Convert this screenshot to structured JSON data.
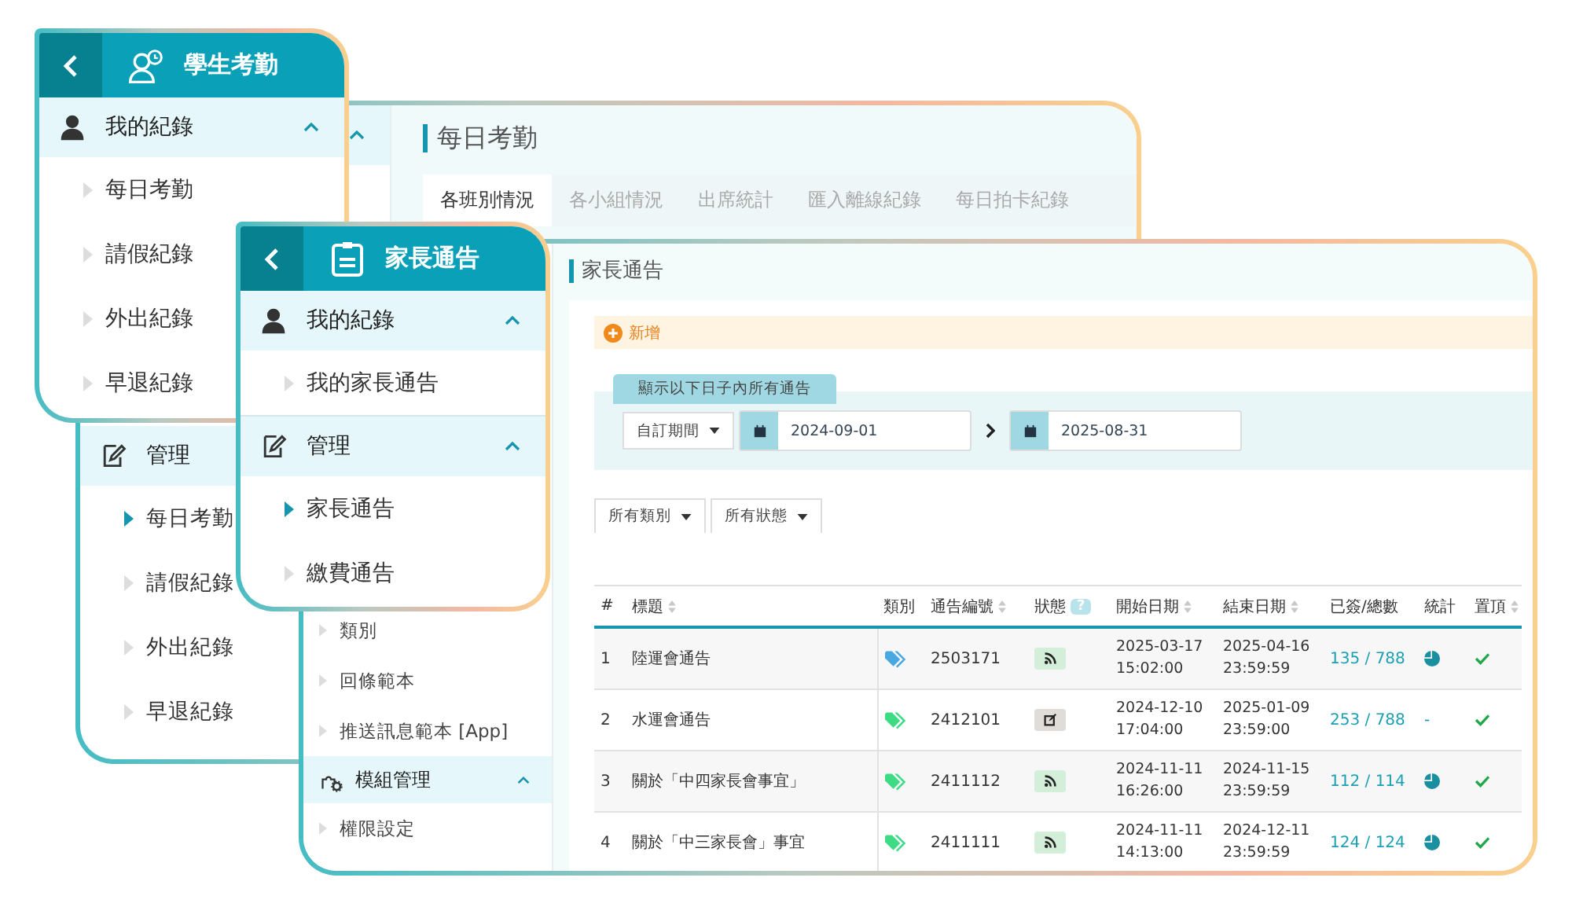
{
  "attendance_window": {
    "top_group": {
      "expanded": true
    },
    "sidebar_group": {
      "label": "管理",
      "items": [
        {
          "label": "每日考勤",
          "selected": true
        },
        {
          "label": "請假紀錄",
          "selected": false
        },
        {
          "label": "外出紀錄",
          "selected": false
        },
        {
          "label": "早退紀錄",
          "selected": false
        }
      ]
    },
    "title": "每日考勤",
    "tabs": [
      {
        "label": "各班別情況",
        "selected": true
      },
      {
        "label": "各小組情況",
        "selected": false
      },
      {
        "label": "出席統計",
        "selected": false
      },
      {
        "label": "匯入離線紀錄",
        "selected": false
      },
      {
        "label": "每日拍卡紀錄",
        "selected": false
      }
    ]
  },
  "attendance_menu": {
    "title": "學生考勤",
    "group": {
      "label": "我的紀錄",
      "expanded": true,
      "items": [
        {
          "label": "每日考勤",
          "selected": false
        },
        {
          "label": "請假紀錄",
          "selected": false
        },
        {
          "label": "外出紀錄",
          "selected": false
        },
        {
          "label": "早退紀錄",
          "selected": false
        }
      ]
    }
  },
  "notice_window": {
    "sidebar": [
      {
        "kind": "item",
        "label": "類別"
      },
      {
        "kind": "item",
        "label": "回條範本"
      },
      {
        "kind": "item",
        "label": "推送訊息範本 [App]"
      },
      {
        "kind": "group",
        "label": "模組管理",
        "expanded": true
      },
      {
        "kind": "item",
        "label": "權限設定"
      }
    ],
    "title": "家長通告",
    "add_button": "新增",
    "date_filter": {
      "label": "顯示以下日子內所有通告",
      "period": "自訂期間",
      "from": "2024-09-01",
      "to": "2025-08-31"
    },
    "filters": [
      "所有類別",
      "所有狀態"
    ],
    "table": {
      "columns": [
        {
          "label": "#",
          "sortable": false
        },
        {
          "label": "標題",
          "sortable": true
        },
        {
          "label": "類別",
          "sortable": false
        },
        {
          "label": "通告編號",
          "sortable": true
        },
        {
          "label": "狀態",
          "sortable": false,
          "help": "?"
        },
        {
          "label": "開始日期",
          "sortable": true
        },
        {
          "label": "結束日期",
          "sortable": true
        },
        {
          "label": "已簽/總數",
          "sortable": false
        },
        {
          "label": "統計",
          "sortable": false
        },
        {
          "label": "置頂",
          "sortable": true
        }
      ],
      "rows": [
        {
          "index": "1",
          "title": "陸運會通告",
          "color": "#4aa8e0",
          "number": "2503171",
          "status": {
            "kind": "published"
          },
          "start": [
            "2025-03-17",
            "15:02:00"
          ],
          "end": [
            "2025-04-16",
            "23:59:59"
          ],
          "signed": "135 / 788",
          "stats": {
            "kind": "chart"
          },
          "pinned": true
        },
        {
          "index": "2",
          "title": "水運會通告",
          "color": "#3ddc84",
          "number": "2412101",
          "status": {
            "kind": "draft"
          },
          "start": [
            "2024-12-10",
            "17:04:00"
          ],
          "end": [
            "2025-01-09",
            "23:59:00"
          ],
          "signed": "253 / 788",
          "stats": {
            "kind": "text",
            "text": "-"
          },
          "pinned": true
        },
        {
          "index": "3",
          "title": "關於「中四家長會事宜」",
          "color": "#3ddc84",
          "number": "2411112",
          "status": {
            "kind": "published"
          },
          "start": [
            "2024-11-11",
            "16:26:00"
          ],
          "end": [
            "2024-11-15",
            "23:59:59"
          ],
          "signed": "112 / 114",
          "stats": {
            "kind": "chart"
          },
          "pinned": true
        },
        {
          "index": "4",
          "title": "關於「中三家長會」事宜",
          "color": "#3ddc84",
          "number": "2411111",
          "status": {
            "kind": "published"
          },
          "start": [
            "2024-11-11",
            "14:13:00"
          ],
          "end": [
            "2024-12-11",
            "23:59:59"
          ],
          "signed": "124 / 124",
          "stats": {
            "kind": "chart"
          },
          "pinned": true
        }
      ]
    }
  },
  "notice_menu": {
    "title": "家長通告",
    "groups": [
      {
        "label": "我的紀錄",
        "expanded": true,
        "items": [
          {
            "label": "我的家長通告",
            "selected": false
          }
        ]
      },
      {
        "label": "管理",
        "expanded": true,
        "items": [
          {
            "label": "家長通告",
            "selected": true
          },
          {
            "label": "繳費通告",
            "selected": false
          }
        ]
      }
    ]
  }
}
